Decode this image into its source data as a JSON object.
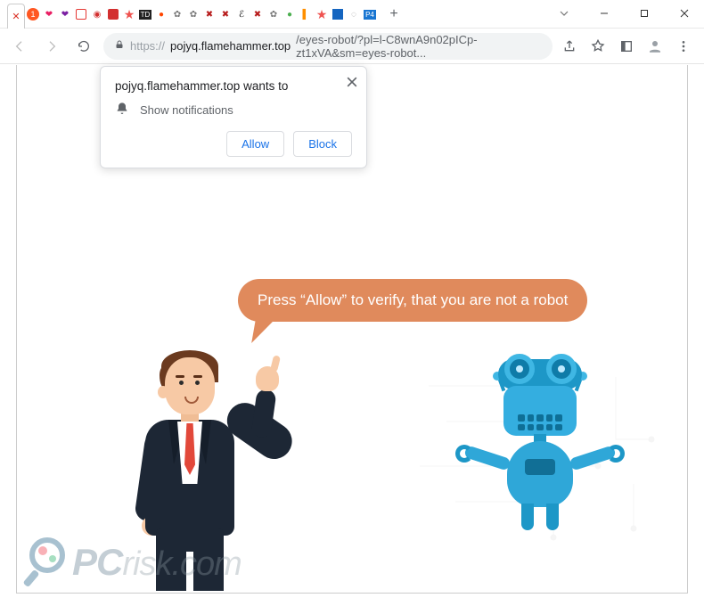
{
  "window": {
    "minimize": "–",
    "maximize": "□",
    "close": "×"
  },
  "tabs": {
    "new_tab_plus": "+"
  },
  "addressbar": {
    "protocol": "https://",
    "host": "pojyq.flamehammer.top",
    "path": "/eyes-robot/?pl=l-C8wnA9n02pICp-zt1xVA&sm=eyes-robot..."
  },
  "permission_prompt": {
    "origin_wants_to": "pojyq.flamehammer.top wants to",
    "permission_label": "Show notifications",
    "allow": "Allow",
    "block": "Block"
  },
  "page": {
    "speech_text": "Press “Allow” to verify, that you are not a robot"
  },
  "watermark": {
    "pc": "PC",
    "risk": "risk.com"
  }
}
